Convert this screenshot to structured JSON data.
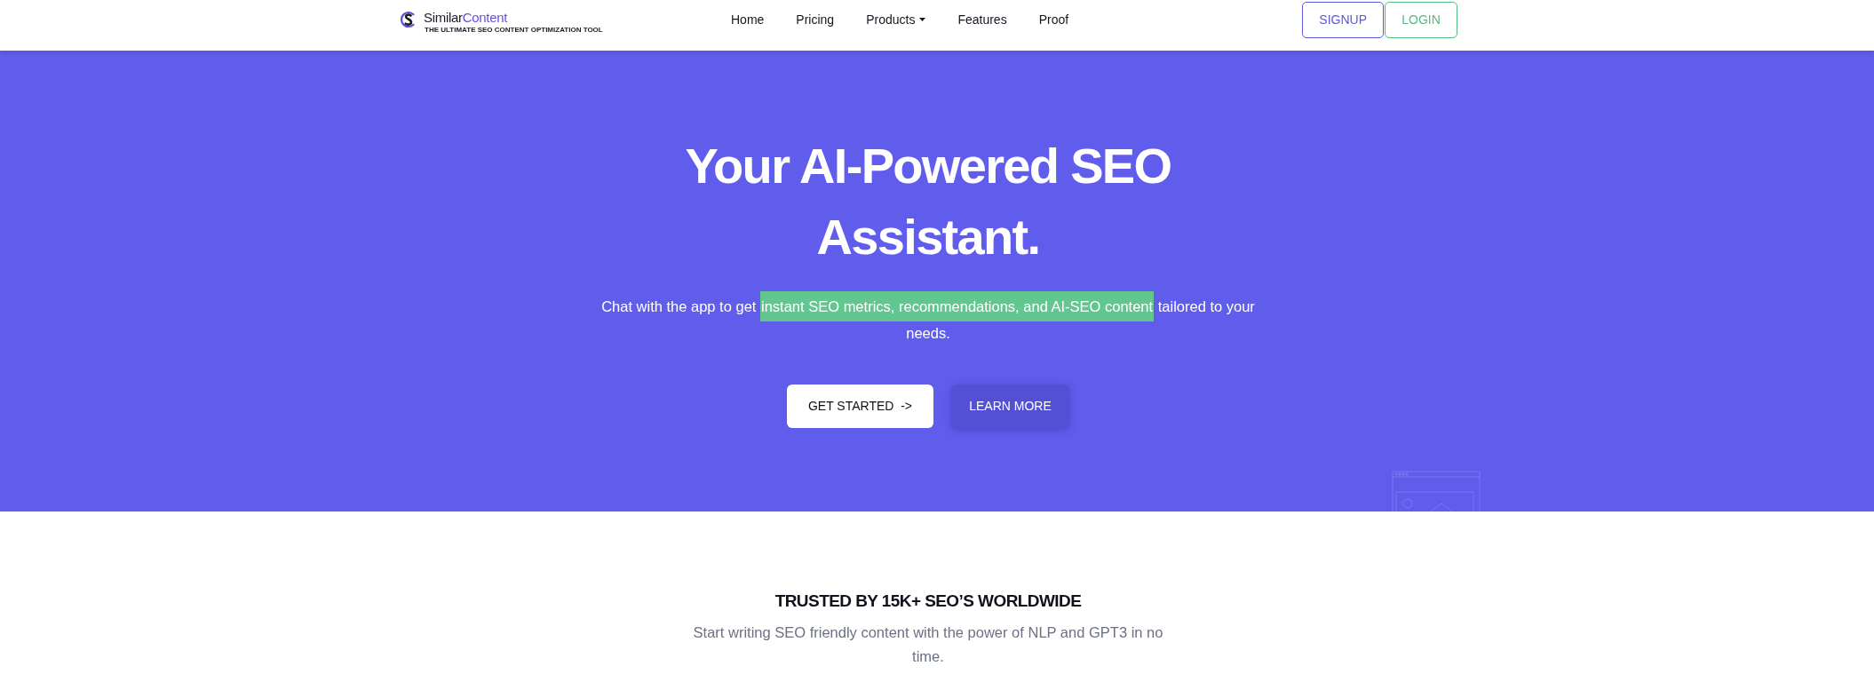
{
  "header": {
    "logo": {
      "wordmark": [
        {
          "text": "Similar",
          "kind": "plain"
        },
        {
          "text": "Content",
          "kind": "accent"
        }
      ],
      "tagline": "THE ULTIMATE SEO CONTENT OPTIMIZATION TOOL"
    },
    "nav": [
      {
        "label": "Home",
        "kind": "link"
      },
      {
        "label": "Pricing",
        "kind": "link"
      },
      {
        "label": "Products",
        "kind": "dropdown"
      },
      {
        "label": "Features",
        "kind": "link"
      },
      {
        "label": "Proof",
        "kind": "link"
      }
    ],
    "auth_buttons": [
      {
        "label": "SIGNUP",
        "color": "#5b58dc"
      },
      {
        "label": "LOGIN",
        "color": "#52b982"
      }
    ]
  },
  "hero": {
    "title": "Your AI-Powered SEO Assistant.",
    "subtitle": [
      {
        "text": "Chat with the app to get ",
        "highlighted": false
      },
      {
        "text": "instant SEO metrics, recommendations, and AI-SEO content",
        "highlighted": true
      },
      {
        "text": " tailored to your needs.",
        "highlighted": false
      }
    ],
    "buttons": [
      {
        "label": "GET STARTED  ->",
        "kind": "primary"
      },
      {
        "label": "LEARN MORE",
        "kind": "secondary"
      }
    ]
  },
  "trusted": {
    "heading": "TRUSTED BY 15K+ SEO’S WORLDWIDE",
    "text": "Start writing SEO friendly content with the power of NLP and GPT3 in no time."
  }
}
